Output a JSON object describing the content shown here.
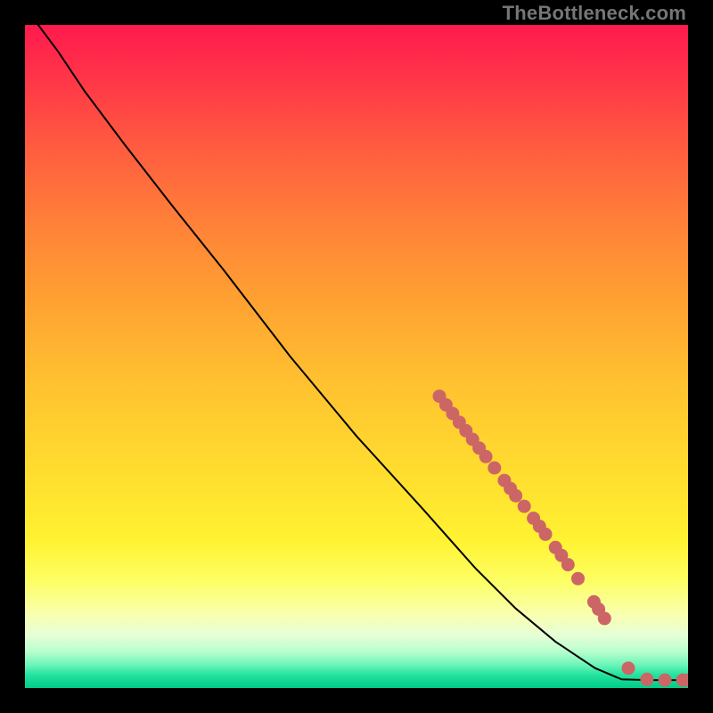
{
  "watermark": "TheBottleneck.com",
  "chart_data": {
    "type": "line",
    "title": "",
    "xlabel": "",
    "ylabel": "",
    "xlim": [
      0,
      100
    ],
    "ylim": [
      0,
      100
    ],
    "grid": false,
    "curve": [
      {
        "x": 2,
        "y": 100
      },
      {
        "x": 5,
        "y": 96
      },
      {
        "x": 9,
        "y": 90
      },
      {
        "x": 15,
        "y": 82
      },
      {
        "x": 22,
        "y": 73
      },
      {
        "x": 30,
        "y": 63
      },
      {
        "x": 40,
        "y": 50
      },
      {
        "x": 50,
        "y": 38
      },
      {
        "x": 60,
        "y": 27
      },
      {
        "x": 68,
        "y": 18
      },
      {
        "x": 74,
        "y": 12
      },
      {
        "x": 80,
        "y": 7
      },
      {
        "x": 86,
        "y": 3
      },
      {
        "x": 90,
        "y": 1.3
      },
      {
        "x": 94,
        "y": 1.2
      },
      {
        "x": 98,
        "y": 1.2
      },
      {
        "x": 100,
        "y": 1.2
      }
    ],
    "markers": [
      {
        "x": 62.5,
        "y": 44
      },
      {
        "x": 63.5,
        "y": 42.7
      },
      {
        "x": 64.5,
        "y": 41.4
      },
      {
        "x": 65.5,
        "y": 40.1
      },
      {
        "x": 66.5,
        "y": 38.8
      },
      {
        "x": 67.5,
        "y": 37.5
      },
      {
        "x": 68.5,
        "y": 36.2
      },
      {
        "x": 69.5,
        "y": 34.9
      },
      {
        "x": 70.8,
        "y": 33.2
      },
      {
        "x": 72.3,
        "y": 31.3
      },
      {
        "x": 73.2,
        "y": 30.1
      },
      {
        "x": 74.0,
        "y": 29.0
      },
      {
        "x": 75.3,
        "y": 27.4
      },
      {
        "x": 76.7,
        "y": 25.6
      },
      {
        "x": 77.6,
        "y": 24.4
      },
      {
        "x": 78.5,
        "y": 23.2
      },
      {
        "x": 80.0,
        "y": 21.2
      },
      {
        "x": 80.9,
        "y": 20.0
      },
      {
        "x": 81.9,
        "y": 18.6
      },
      {
        "x": 83.4,
        "y": 16.5
      },
      {
        "x": 85.8,
        "y": 13.0
      },
      {
        "x": 86.5,
        "y": 11.9
      },
      {
        "x": 87.4,
        "y": 10.5
      },
      {
        "x": 91.0,
        "y": 3.0
      },
      {
        "x": 93.8,
        "y": 1.3
      },
      {
        "x": 96.5,
        "y": 1.2
      },
      {
        "x": 99.2,
        "y": 1.2
      },
      {
        "x": 100,
        "y": 1.2
      }
    ],
    "colors": {
      "curve": "#000000",
      "marker": "#cc6666",
      "gradient_top": "#ff1a4d",
      "gradient_mid": "#ffd530",
      "gradient_bottom": "#00cc88"
    }
  }
}
